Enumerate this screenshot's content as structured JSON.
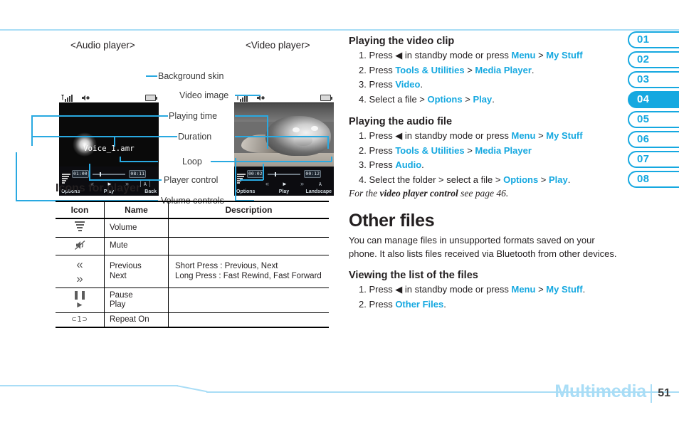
{
  "figure": {
    "audio_caption": "<Audio player>",
    "video_caption": "<Video player>",
    "audio_screen": {
      "filename": "Voice_1.amr",
      "playing_time": "01:00",
      "duration": "08:11",
      "loop": "A",
      "softkeys": [
        "Options",
        "Play",
        "Back"
      ]
    },
    "video_screen": {
      "playing_time": "00:02",
      "duration": "00:12",
      "loop": "A",
      "softkeys": [
        "Options",
        "Play",
        "Landscape"
      ]
    },
    "callouts": [
      "Background skin",
      "Video image",
      "Playing time",
      "Duration",
      "Loop",
      "Player control",
      "Volume controls"
    ]
  },
  "icons_table": {
    "heading": "Icons for player",
    "columns": [
      "Icon",
      "Name",
      "Description"
    ],
    "rows": [
      {
        "icons": [
          "volume-bars-icon"
        ],
        "names": [
          "Volume"
        ],
        "description": ""
      },
      {
        "icons": [
          "mute-icon"
        ],
        "names": [
          "Mute"
        ],
        "description": ""
      },
      {
        "icons": [
          "previous-icon",
          "next-icon"
        ],
        "names": [
          "Previous",
          "Next"
        ],
        "description": "Short Press : Previous, Next\nLong Press : Fast Rewind, Fast Forward",
        "description_line1": "Short Press : Previous, Next",
        "description_line2": "Long Press : Fast Rewind, Fast Forward"
      },
      {
        "icons": [
          "pause-icon",
          "play-icon"
        ],
        "names": [
          "Pause",
          "Play"
        ],
        "description": ""
      },
      {
        "icons": [
          "repeat-on-icon"
        ],
        "names": [
          "Repeat On"
        ],
        "description": ""
      }
    ]
  },
  "right_column": {
    "video_clip": {
      "heading": "Playing the video clip",
      "steps": [
        {
          "num": "1.",
          "parts": [
            {
              "t": "Press ◀ in standby mode or press ",
              "k": false
            },
            {
              "t": "Menu",
              "k": true
            },
            {
              "t": " > ",
              "k": false
            },
            {
              "t": "My Stuff",
              "k": true
            }
          ]
        },
        {
          "num": "2.",
          "parts": [
            {
              "t": "Press ",
              "k": false
            },
            {
              "t": "Tools & Utilities",
              "k": true
            },
            {
              "t": " > ",
              "k": false
            },
            {
              "t": "Media Player",
              "k": true
            },
            {
              "t": ".",
              "k": false
            }
          ]
        },
        {
          "num": "3.",
          "parts": [
            {
              "t": "Press ",
              "k": false
            },
            {
              "t": "Video",
              "k": true
            },
            {
              "t": ".",
              "k": false
            }
          ]
        },
        {
          "num": "4.",
          "parts": [
            {
              "t": "Select a file > ",
              "k": false
            },
            {
              "t": "Options",
              "k": true
            },
            {
              "t": " > ",
              "k": false
            },
            {
              "t": "Play",
              "k": true
            },
            {
              "t": ".",
              "k": false
            }
          ]
        }
      ]
    },
    "audio_file": {
      "heading": "Playing the audio file",
      "steps": [
        {
          "num": "1.",
          "parts": [
            {
              "t": "Press ◀ in standby mode or press ",
              "k": false
            },
            {
              "t": "Menu",
              "k": true
            },
            {
              "t": " > ",
              "k": false
            },
            {
              "t": "My Stuff",
              "k": true
            }
          ]
        },
        {
          "num": "2.",
          "parts": [
            {
              "t": "Press ",
              "k": false
            },
            {
              "t": "Tools & Utilities",
              "k": true
            },
            {
              "t": " > ",
              "k": false
            },
            {
              "t": "Media Player",
              "k": true
            }
          ]
        },
        {
          "num": "3.",
          "parts": [
            {
              "t": "Press ",
              "k": false
            },
            {
              "t": "Audio",
              "k": true
            },
            {
              "t": ".",
              "k": false
            }
          ]
        },
        {
          "num": "4.",
          "parts": [
            {
              "t": "Select the folder > select a file > ",
              "k": false
            },
            {
              "t": "Options",
              "k": true
            },
            {
              "t": " > ",
              "k": false
            },
            {
              "t": "Play",
              "k": true
            },
            {
              "t": ".",
              "k": false
            }
          ]
        }
      ],
      "note_parts": [
        {
          "t": "For the ",
          "b": false
        },
        {
          "t": "video player control",
          "b": true
        },
        {
          "t": " see page 46.",
          "b": false
        }
      ]
    },
    "other_files": {
      "heading": "Other files",
      "body": "You can manage files in unsupported formats saved on your phone. It also lists files received via Bluetooth from other devices."
    },
    "viewing_list": {
      "heading": "Viewing the list of the files",
      "steps": [
        {
          "num": "1.",
          "parts": [
            {
              "t": "Press ◀ in standby mode or press ",
              "k": false
            },
            {
              "t": "Menu",
              "k": true
            },
            {
              "t": " > ",
              "k": false
            },
            {
              "t": "My Stuff",
              "k": true
            },
            {
              "t": ".",
              "k": false
            }
          ]
        },
        {
          "num": "2.",
          "parts": [
            {
              "t": "Press ",
              "k": false
            },
            {
              "t": "Other Files",
              "k": true
            },
            {
              "t": ".",
              "k": false
            }
          ]
        }
      ]
    }
  },
  "tabs": {
    "items": [
      "01",
      "02",
      "03",
      "04",
      "05",
      "06",
      "07",
      "08"
    ],
    "active": "04"
  },
  "footer": {
    "title": "Multimedia",
    "page_number": "51"
  },
  "colors": {
    "accent": "#15a8e0",
    "accent_light": "#a9ddf6",
    "text": "#231f20"
  }
}
